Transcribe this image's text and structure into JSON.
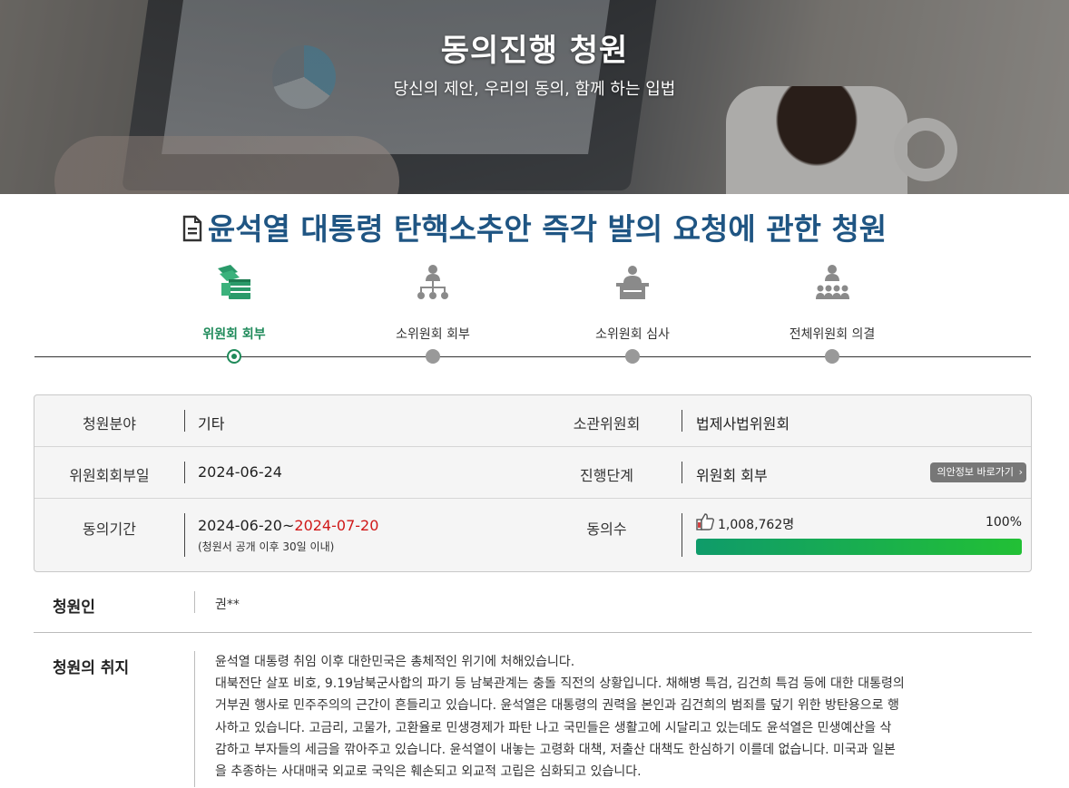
{
  "hero": {
    "title": "동의진행 청원",
    "subtitle": "당신의 제안, 우리의 동의, 함께 하는 입법"
  },
  "petition": {
    "title": "윤석열 대통령 탄핵소추안 즉각 발의 요청에 관한 청원"
  },
  "steps": [
    {
      "label": "위원회 회부",
      "icon": "documents-icon",
      "active": true
    },
    {
      "label": "소위원회 회부",
      "icon": "org-chart-icon",
      "active": false
    },
    {
      "label": "소위원회 심사",
      "icon": "podium-speaker-icon",
      "active": false
    },
    {
      "label": "전체위원회 의결",
      "icon": "assembly-icon",
      "active": false
    }
  ],
  "info": {
    "field_label": "청원분야",
    "field_value": "기타",
    "committee_label": "소관위원회",
    "committee_value": "법제사법위원회",
    "referral_date_label": "위원회회부일",
    "referral_date_value": "2024-06-24",
    "stage_label": "진행단계",
    "stage_value": "위원회 회부",
    "bill_info_button": "의안정보 바로가기",
    "period_label": "동의기간",
    "period_start": "2024-06-20~",
    "period_end": "2024-07-20",
    "period_note": "(청원서 공개 이후 30일 이내)",
    "agree_label": "동의수",
    "agree_count": "1,008,762명",
    "agree_percent": "100%",
    "agree_progress": 1.0
  },
  "petitioner": {
    "label": "청원인",
    "value": "권**"
  },
  "purpose": {
    "label": "청원의 취지",
    "lines": [
      "윤석열 대통령 취임 이후 대한민국은 총체적인 위기에 처해있습니다.",
      "대북전단 살포 비호, 9.19남북군사합의 파기 등 남북관계는 충돌 직전의 상황입니다. 채해병 특검, 김건희 특검 등에 대한 대통령의",
      "거부권 행사로 민주주의의 근간이 흔들리고 있습니다. 윤석열은 대통령의 권력을 본인과 김건희의 범죄를 덮기 위한 방탄용으로 행",
      "사하고 있습니다. 고금리, 고물가, 고환율로 민생경제가 파탄 나고 국민들은 생활고에 시달리고 있는데도 윤석열은 민생예산을 삭",
      "감하고 부자들의 세금을 깎아주고 있습니다. 윤석열이 내놓는 고령화 대책, 저출산 대책도 한심하기 이를데 없습니다. 미국과 일본",
      "을 추종하는 사대매국 외교로 국익은 훼손되고 외교적 고립은 심화되고 있습니다."
    ]
  },
  "colors": {
    "title_blue": "#1f5583",
    "active_green": "#1f8a5a",
    "deadline_red": "#d01818"
  }
}
